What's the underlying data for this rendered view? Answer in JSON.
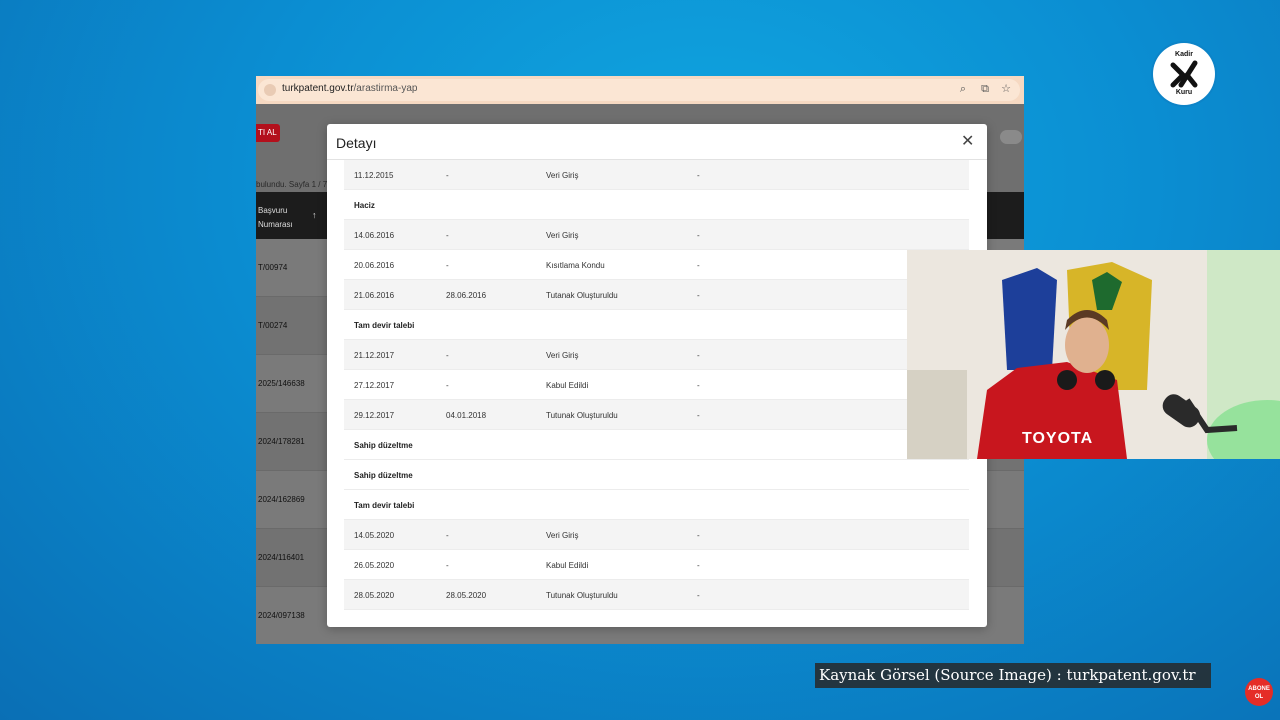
{
  "logo": {
    "top_text": "Kadir",
    "bottom_text": "Kuru"
  },
  "browser": {
    "url_domain": "turkpatent.gov.tr",
    "url_path": "/arastirma-yap"
  },
  "background_page": {
    "red_button_label": "TI AL",
    "results_info": "bulundu. Sayfa 1 / 7",
    "column_header_line1": "Başvuru",
    "column_header_line2": "Numarası",
    "rows": [
      "T/00974",
      "T/00274",
      "2025/146638",
      "2024/178281",
      "2024/162869",
      "2024/116401",
      "2024/097138"
    ]
  },
  "modal": {
    "title": "Detayı",
    "close_icon": "close-icon",
    "rows": [
      {
        "type": "entry",
        "c1": "11.12.2015",
        "c2": "-",
        "c3": "Veri Giriş",
        "c4": "-"
      },
      {
        "type": "section",
        "label": "Haciz"
      },
      {
        "type": "entry",
        "c1": "14.06.2016",
        "c2": "-",
        "c3": "Veri Giriş",
        "c4": "-"
      },
      {
        "type": "entry",
        "c1": "20.06.2016",
        "c2": "-",
        "c3": "Kısıtlama Kondu",
        "c4": "-"
      },
      {
        "type": "entry",
        "c1": "21.06.2016",
        "c2": "28.06.2016",
        "c3": "Tutanak Oluşturuldu",
        "c4": "-"
      },
      {
        "type": "section",
        "label": "Tam devir talebi"
      },
      {
        "type": "entry",
        "c1": "21.12.2017",
        "c2": "-",
        "c3": "Veri Giriş",
        "c4": "-"
      },
      {
        "type": "entry",
        "c1": "27.12.2017",
        "c2": "-",
        "c3": "Kabul Edildi",
        "c4": "-"
      },
      {
        "type": "entry",
        "c1": "29.12.2017",
        "c2": "04.01.2018",
        "c3": "Tutunak Oluşturuldu",
        "c4": "-"
      },
      {
        "type": "section",
        "label": "Sahip düzeltme"
      },
      {
        "type": "section",
        "label": "Sahip düzeltme"
      },
      {
        "type": "section",
        "label": "Tam devir talebi"
      },
      {
        "type": "entry",
        "c1": "14.05.2020",
        "c2": "-",
        "c3": "Veri Giriş",
        "c4": "-"
      },
      {
        "type": "entry",
        "c1": "26.05.2020",
        "c2": "-",
        "c3": "Kabul Edildi",
        "c4": "-"
      },
      {
        "type": "entry",
        "c1": "28.05.2020",
        "c2": "28.05.2020",
        "c3": "Tutunak Oluşturuldu",
        "c4": "-"
      }
    ]
  },
  "webcam": {
    "jersey_text": "TOYOTA"
  },
  "credit": "Kaynak Görsel (Source Image) : turkpatent.gov.tr",
  "abone": {
    "line1": "ABONE",
    "line2": "OL"
  },
  "colors": {
    "background": "#0b8ed2",
    "accent_red": "#b3101c",
    "url_bar": "#f6d9c2"
  }
}
